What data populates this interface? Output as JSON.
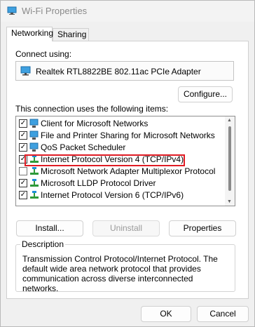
{
  "window": {
    "title": "Wi-Fi Properties",
    "colors": {
      "highlight": "#e01c24",
      "icon": "#1d8fd8"
    }
  },
  "tabs": [
    {
      "label": "Networking",
      "active": true
    },
    {
      "label": "Sharing",
      "active": false
    }
  ],
  "connect_using": {
    "label": "Connect using:",
    "adapter": "Realtek RTL8822BE 802.11ac PCIe Adapter",
    "icon": "network-adapter-icon",
    "configure_label": "Configure..."
  },
  "items_section": {
    "label": "This connection uses the following items:",
    "items": [
      {
        "label": "Client for Microsoft Networks",
        "checked": true,
        "icon": "client-network-icon"
      },
      {
        "label": "File and Printer Sharing for Microsoft Networks",
        "checked": true,
        "icon": "file-printer-sharing-icon"
      },
      {
        "label": "QoS Packet Scheduler",
        "checked": true,
        "icon": "qos-scheduler-icon"
      },
      {
        "label": "Internet Protocol Version 4 (TCP/IPv4)",
        "checked": true,
        "icon": "protocol-icon",
        "highlighted": true
      },
      {
        "label": "Microsoft Network Adapter Multiplexor Protocol",
        "checked": false,
        "icon": "protocol-icon"
      },
      {
        "label": "Microsoft LLDP Protocol Driver",
        "checked": true,
        "icon": "protocol-icon"
      },
      {
        "label": "Internet Protocol Version 6 (TCP/IPv6)",
        "checked": true,
        "icon": "protocol-icon"
      }
    ],
    "install_label": "Install...",
    "uninstall_label": "Uninstall",
    "properties_label": "Properties"
  },
  "description": {
    "title": "Description",
    "text": "Transmission Control Protocol/Internet Protocol. The default wide area network protocol that provides communication across diverse interconnected networks."
  },
  "footer": {
    "ok_label": "OK",
    "cancel_label": "Cancel"
  }
}
